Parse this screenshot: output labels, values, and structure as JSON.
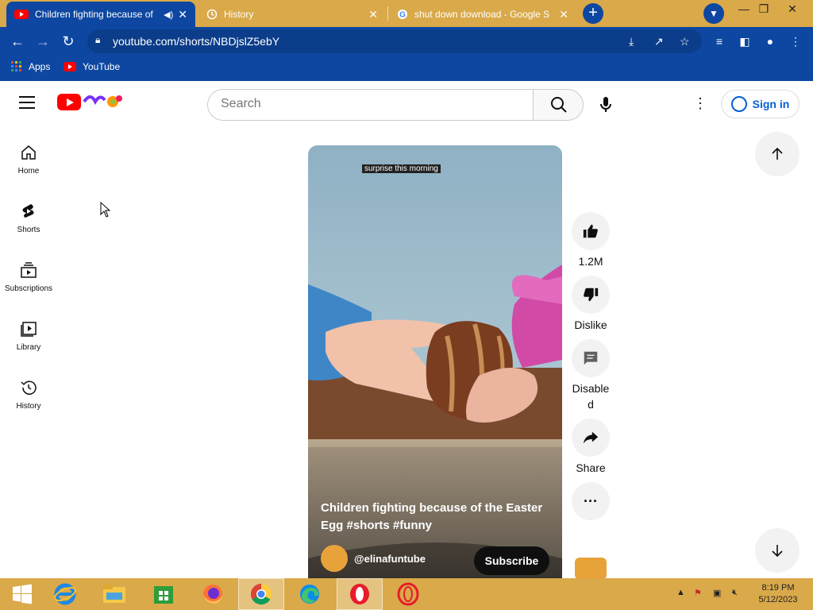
{
  "browser": {
    "tabs": [
      {
        "title": "Children fighting because of",
        "icon": "youtube-icon",
        "active": true
      },
      {
        "title": "History",
        "icon": "history-icon",
        "active": false
      },
      {
        "title": "shut down download - Google S",
        "icon": "google-icon",
        "active": false
      }
    ],
    "url": "youtube.com/shorts/NBDjslZ5ebY",
    "bookmarks": [
      {
        "label": "Apps",
        "icon": "apps-grid-icon"
      },
      {
        "label": "YouTube",
        "icon": "youtube-icon"
      }
    ],
    "accent": "#0d47a1",
    "frame_color": "#d9a94a"
  },
  "youtube": {
    "search_placeholder": "Search",
    "sign_in": "Sign in",
    "guide": [
      {
        "label": "Home",
        "icon": "home-icon"
      },
      {
        "label": "Shorts",
        "icon": "shorts-icon"
      },
      {
        "label": "Subscriptions",
        "icon": "subscriptions-icon"
      },
      {
        "label": "Library",
        "icon": "library-icon"
      },
      {
        "label": "History",
        "icon": "history-icon"
      }
    ],
    "short": {
      "caption": "surprise this morning",
      "title": "Children fighting because of the Easter Egg #shorts #funny",
      "channel": "@elinafuntube",
      "subscribe": "Subscribe"
    },
    "actions": {
      "like": "1.2M",
      "dislike": "Dislike",
      "comments": "Disable\nd",
      "share": "Share"
    }
  },
  "taskbar": {
    "time": "8:19 PM",
    "date": "5/12/2023",
    "apps": [
      "start-icon",
      "internet-explorer-icon",
      "file-explorer-icon",
      "store-icon",
      "firefox-icon",
      "chrome-icon",
      "edge-icon",
      "opera-icon",
      "opera-gx-icon"
    ]
  }
}
